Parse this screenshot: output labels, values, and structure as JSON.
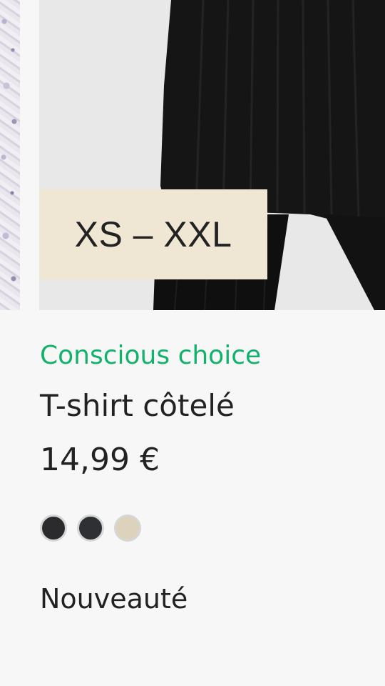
{
  "product": {
    "size_range": "XS – XXL",
    "label": "Conscious choice",
    "title": "T-shirt côtelé",
    "price": "14,99 €",
    "badge": "Nouveauté",
    "swatches": [
      {
        "name": "black",
        "color": "#2b2b2d"
      },
      {
        "name": "dark-grey",
        "color": "#2f3033"
      },
      {
        "name": "beige",
        "color": "#ddd3bd"
      }
    ]
  },
  "colors": {
    "conscious_green": "#11b36b",
    "badge_background": "#efe7d3"
  }
}
